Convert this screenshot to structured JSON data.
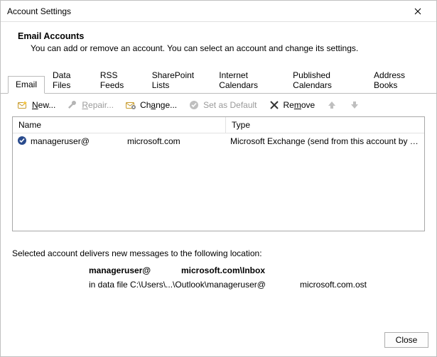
{
  "window": {
    "title": "Account Settings"
  },
  "intro": {
    "heading": "Email Accounts",
    "description": "You can add or remove an account. You can select an account and change its settings."
  },
  "tabs": {
    "items": [
      {
        "label": "Email",
        "active": true
      },
      {
        "label": "Data Files"
      },
      {
        "label": "RSS Feeds"
      },
      {
        "label": "SharePoint Lists"
      },
      {
        "label": "Internet Calendars"
      },
      {
        "label": "Published Calendars"
      },
      {
        "label": "Address Books"
      }
    ]
  },
  "toolbar": {
    "new_label": "New...",
    "repair_label": "Repair...",
    "change_label": "Change...",
    "default_label": "Set as Default",
    "remove_label": "Remove"
  },
  "list": {
    "columns": {
      "name": "Name",
      "type": "Type"
    },
    "rows": [
      {
        "name_part1": "manageruser@",
        "name_part2": "microsoft.com",
        "type": "Microsoft Exchange (send from this account by def..."
      }
    ]
  },
  "delivery": {
    "intro": "Selected account delivers new messages to the following location:",
    "loc_part1": "manageruser@",
    "loc_part2": "microsoft.com\\Inbox",
    "path_part1": "in data file C:\\Users\\...\\Outlook\\manageruser@",
    "path_part2": "microsoft.com.ost"
  },
  "footer": {
    "close_label": "Close"
  }
}
